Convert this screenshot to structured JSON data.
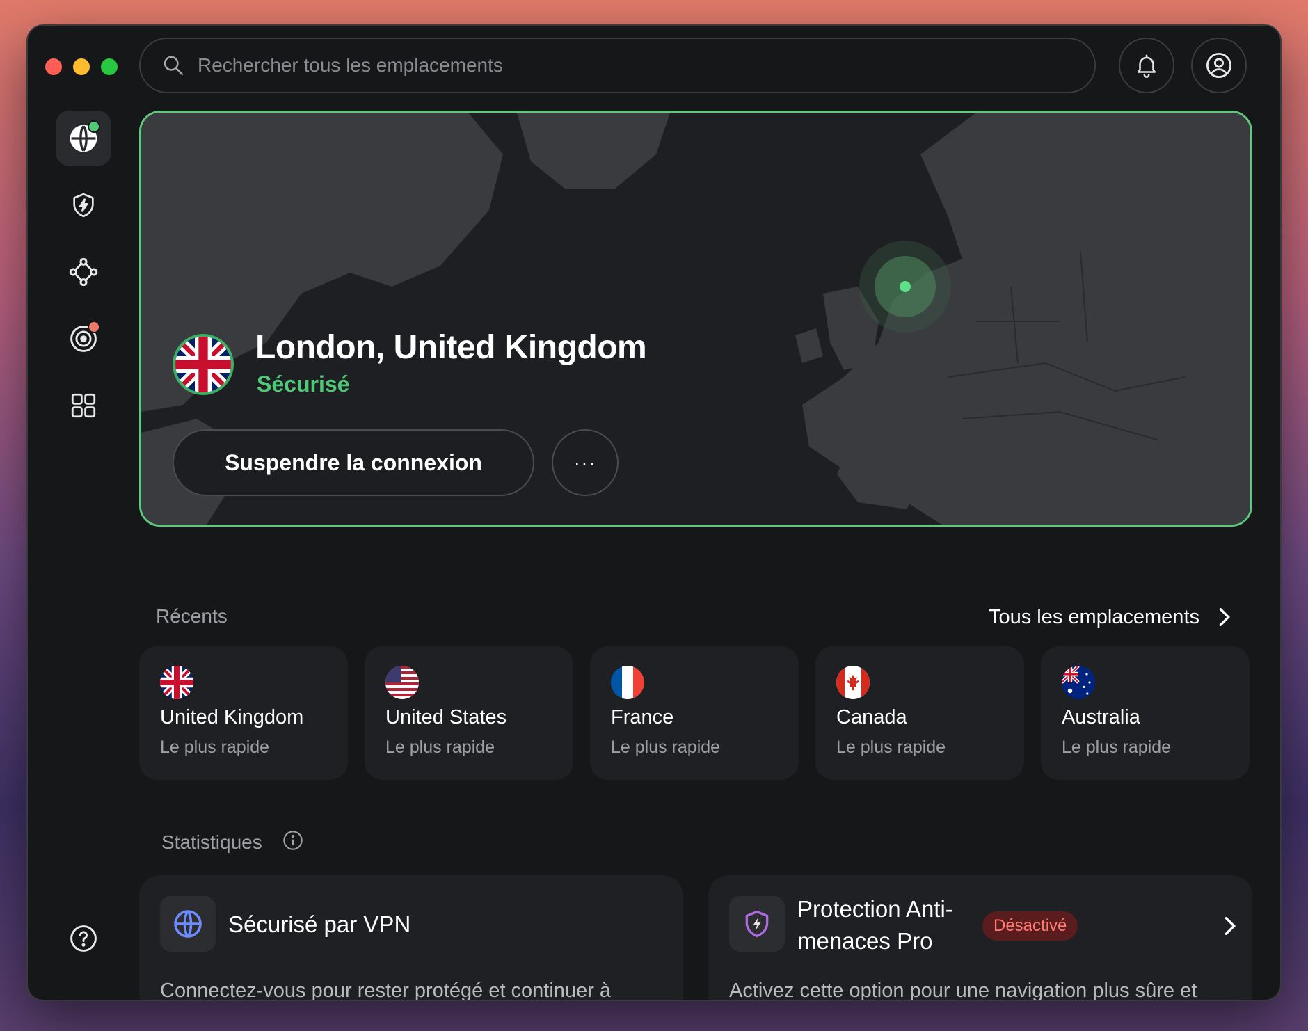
{
  "search": {
    "placeholder": "Rechercher tous les emplacements"
  },
  "sidebar": {
    "items": [
      {
        "icon": "globe-icon",
        "active": true
      },
      {
        "icon": "shield-bolt-icon"
      },
      {
        "icon": "network-nodes-icon"
      },
      {
        "icon": "target-icon"
      },
      {
        "icon": "grid-icon"
      }
    ],
    "help_icon": "help-icon"
  },
  "connection": {
    "location": "London, United Kingdom",
    "status": "Sécurisé",
    "suspend_label": "Suspendre la connexion",
    "more_label": "···"
  },
  "recents": {
    "title": "Récents",
    "all_locations_label": "Tous les emplacements",
    "items": [
      {
        "country": "United Kingdom",
        "sub": "Le plus rapide"
      },
      {
        "country": "United States",
        "sub": "Le plus rapide"
      },
      {
        "country": "France",
        "sub": "Le plus rapide"
      },
      {
        "country": "Canada",
        "sub": "Le plus rapide"
      },
      {
        "country": "Australia",
        "sub": "Le plus rapide"
      }
    ]
  },
  "stats": {
    "title": "Statistiques",
    "cards": [
      {
        "title": "Sécurisé par VPN",
        "desc": "Connectez-vous pour rester protégé et continuer à"
      },
      {
        "title_line1": "Protection Anti-",
        "title_line2": "menaces Pro",
        "badge": "Désactivé",
        "desc": "Activez cette option pour une navigation plus sûre et"
      }
    ]
  },
  "colors": {
    "accent_green": "#4ec977",
    "badge_red": "#ff7b72",
    "window_bg": "#161719",
    "card_bg": "#1f2023"
  }
}
